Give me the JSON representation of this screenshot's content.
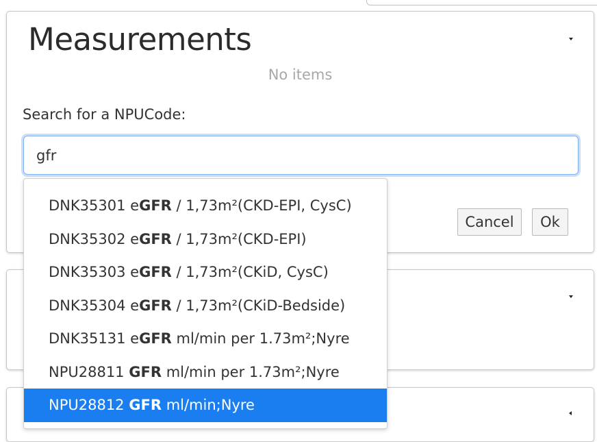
{
  "measurements": {
    "title": "Measurements",
    "empty_text": "No items",
    "search": {
      "label": "Search for a NPUCode:",
      "value": "gfr"
    },
    "buttons": {
      "cancel": "Cancel",
      "ok": "Ok"
    }
  },
  "dropdown": {
    "options": [
      {
        "code": "DNK35301",
        "pre": "e",
        "match": "GFR",
        "post": " / 1,73m²(CKD-EPI, CysC)"
      },
      {
        "code": "DNK35302",
        "pre": "e",
        "match": "GFR",
        "post": " / 1,73m²(CKD-EPI)"
      },
      {
        "code": "DNK35303",
        "pre": "e",
        "match": "GFR",
        "post": " / 1,73m²(CKiD, CysC)"
      },
      {
        "code": "DNK35304",
        "pre": "e",
        "match": "GFR",
        "post": " / 1,73m²(CKiD-Bedside)"
      },
      {
        "code": "DNK35131",
        "pre": "e",
        "match": "GFR",
        "post": " ml/min per 1.73m²;Nyre"
      },
      {
        "code": "NPU28811",
        "pre": "",
        "match": "GFR",
        "post": " ml/min per 1.73m²;Nyre"
      },
      {
        "code": "NPU28812",
        "pre": "",
        "match": "GFR",
        "post": " ml/min;Nyre"
      }
    ],
    "highlight_color": "#1a7ef0"
  }
}
